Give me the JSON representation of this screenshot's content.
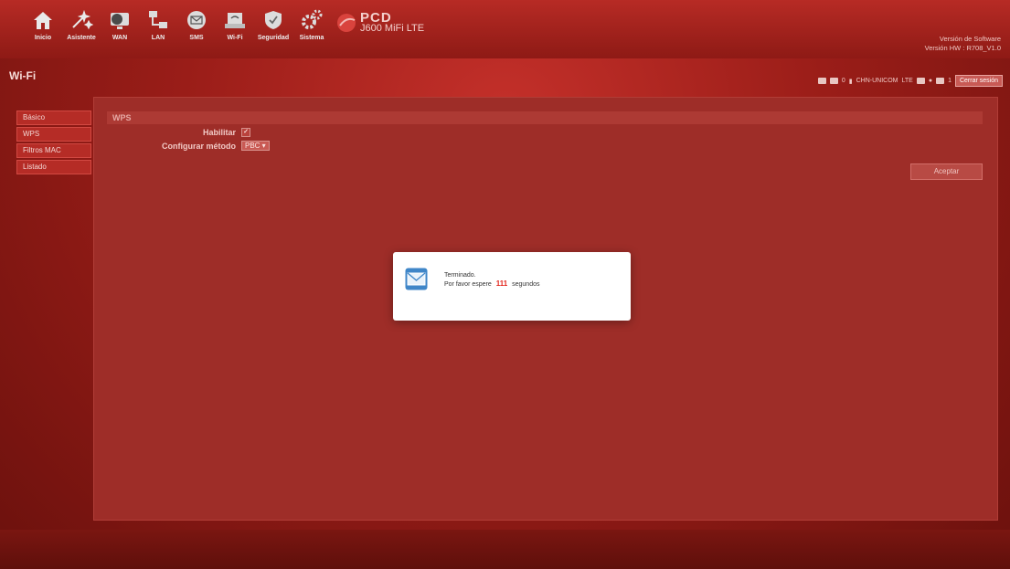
{
  "nav": {
    "items": [
      {
        "label": "Inicio",
        "icon": "home-icon"
      },
      {
        "label": "Asistente",
        "icon": "wand-icon"
      },
      {
        "label": "WAN",
        "icon": "globe-monitor-icon"
      },
      {
        "label": "LAN",
        "icon": "network-icon"
      },
      {
        "label": "SMS",
        "icon": "envelope-icon"
      },
      {
        "label": "Wi-Fi",
        "icon": "wifi-icon"
      },
      {
        "label": "Seguridad",
        "icon": "shield-icon"
      },
      {
        "label": "Sistema",
        "icon": "gears-icon"
      }
    ]
  },
  "brand": {
    "name": "PCD",
    "model": "J600 MiFi LTE"
  },
  "version": {
    "software": "Versión de Software",
    "hw": "Versión HW : R708_V1.0"
  },
  "page": {
    "title": "Wi-Fi"
  },
  "status": {
    "signal_count": "0",
    "operator": "CHN-UNICOM",
    "network": "LTE",
    "clients": "1",
    "logout_label": "Cerrar sesión"
  },
  "sidebar": {
    "items": [
      {
        "label": "Básico"
      },
      {
        "label": "WPS"
      },
      {
        "label": "Filtros MAC"
      },
      {
        "label": "Listado"
      }
    ]
  },
  "wps": {
    "section_title": "WPS",
    "enable_label": "Habilitar",
    "enable_checked": true,
    "method_label": "Configurar método",
    "method_value": "PBC",
    "accept_label": "Aceptar"
  },
  "dialog": {
    "line1": "Terminado.",
    "wait_prefix": "Por favor espere",
    "seconds": "111",
    "wait_suffix": "segundos"
  },
  "colors": {
    "brand_red": "#b72b25",
    "countdown_red": "#e2231a"
  }
}
